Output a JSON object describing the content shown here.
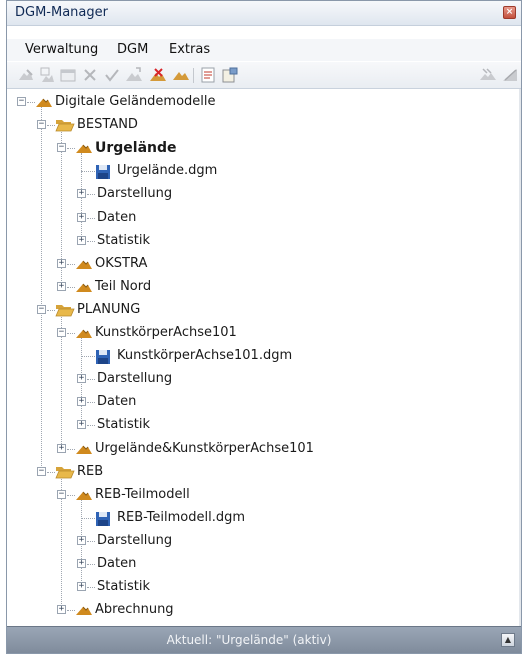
{
  "window": {
    "title": "DGM-Manager",
    "close_glyph": "×"
  },
  "menu": [
    {
      "label": "Verwaltung"
    },
    {
      "label": "DGM"
    },
    {
      "label": "Extras"
    }
  ],
  "toolbar": {
    "icons": [
      "terrain-edit-icon",
      "terrain-copy-icon",
      "window-icon",
      "delete-icon",
      "check-icon",
      "terrain-export-icon",
      "terrain-delete-icon",
      "terrain-add-icon",
      "list-icon",
      "properties-icon",
      "terrain-split-icon",
      "terrain-slope-icon"
    ]
  },
  "tree": [
    {
      "label": "Digitale Geländemodelle",
      "icon": "terrain-icon",
      "expander": "−",
      "bold": false
    },
    {
      "label": "BESTAND",
      "icon": "folder-open-icon",
      "expander": "−",
      "bold": false
    },
    {
      "label": "Urgelände",
      "icon": "terrain-icon",
      "expander": "−",
      "bold": true
    },
    {
      "label": "Urgelände.dgm",
      "icon": "dgm-file-icon",
      "expander": "",
      "bold": false
    },
    {
      "label": "Darstellung",
      "icon": "",
      "expander": "+",
      "bold": false
    },
    {
      "label": "Daten",
      "icon": "",
      "expander": "+",
      "bold": false
    },
    {
      "label": "Statistik",
      "icon": "",
      "expander": "+",
      "bold": false
    },
    {
      "label": "OKSTRA",
      "icon": "terrain-icon",
      "expander": "+",
      "bold": false
    },
    {
      "label": "Teil Nord",
      "icon": "terrain-icon",
      "expander": "+",
      "bold": false
    },
    {
      "label": "PLANUNG",
      "icon": "folder-open-icon",
      "expander": "−",
      "bold": false
    },
    {
      "label": "KunstkörperAchse101",
      "icon": "terrain-icon",
      "expander": "−",
      "bold": false
    },
    {
      "label": "KunstkörperAchse101.dgm",
      "icon": "dgm-file-icon",
      "expander": "",
      "bold": false
    },
    {
      "label": "Darstellung",
      "icon": "",
      "expander": "+",
      "bold": false
    },
    {
      "label": "Daten",
      "icon": "",
      "expander": "+",
      "bold": false
    },
    {
      "label": "Statistik",
      "icon": "",
      "expander": "+",
      "bold": false
    },
    {
      "label": "Urgelände&KunstkörperAchse101",
      "icon": "terrain-icon",
      "expander": "+",
      "bold": false
    },
    {
      "label": "REB",
      "icon": "folder-open-icon",
      "expander": "−",
      "bold": false
    },
    {
      "label": "REB-Teilmodell",
      "icon": "terrain-icon",
      "expander": "−",
      "bold": false
    },
    {
      "label": "REB-Teilmodell.dgm",
      "icon": "dgm-file-icon",
      "expander": "",
      "bold": false
    },
    {
      "label": "Darstellung",
      "icon": "",
      "expander": "+",
      "bold": false
    },
    {
      "label": "Daten",
      "icon": "",
      "expander": "+",
      "bold": false
    },
    {
      "label": "Statistik",
      "icon": "",
      "expander": "+",
      "bold": false
    },
    {
      "label": "Abrechnung",
      "icon": "terrain-icon",
      "expander": "+",
      "bold": false
    }
  ],
  "status": {
    "text": "Aktuell: \"Urgelände\" (aktiv)",
    "button_glyph": "▲"
  },
  "colors": {
    "terrain": "#d08a1e",
    "folder": "#e8b84a",
    "dgm_file": "#2f63b5",
    "statusbar": "#8995a6"
  }
}
